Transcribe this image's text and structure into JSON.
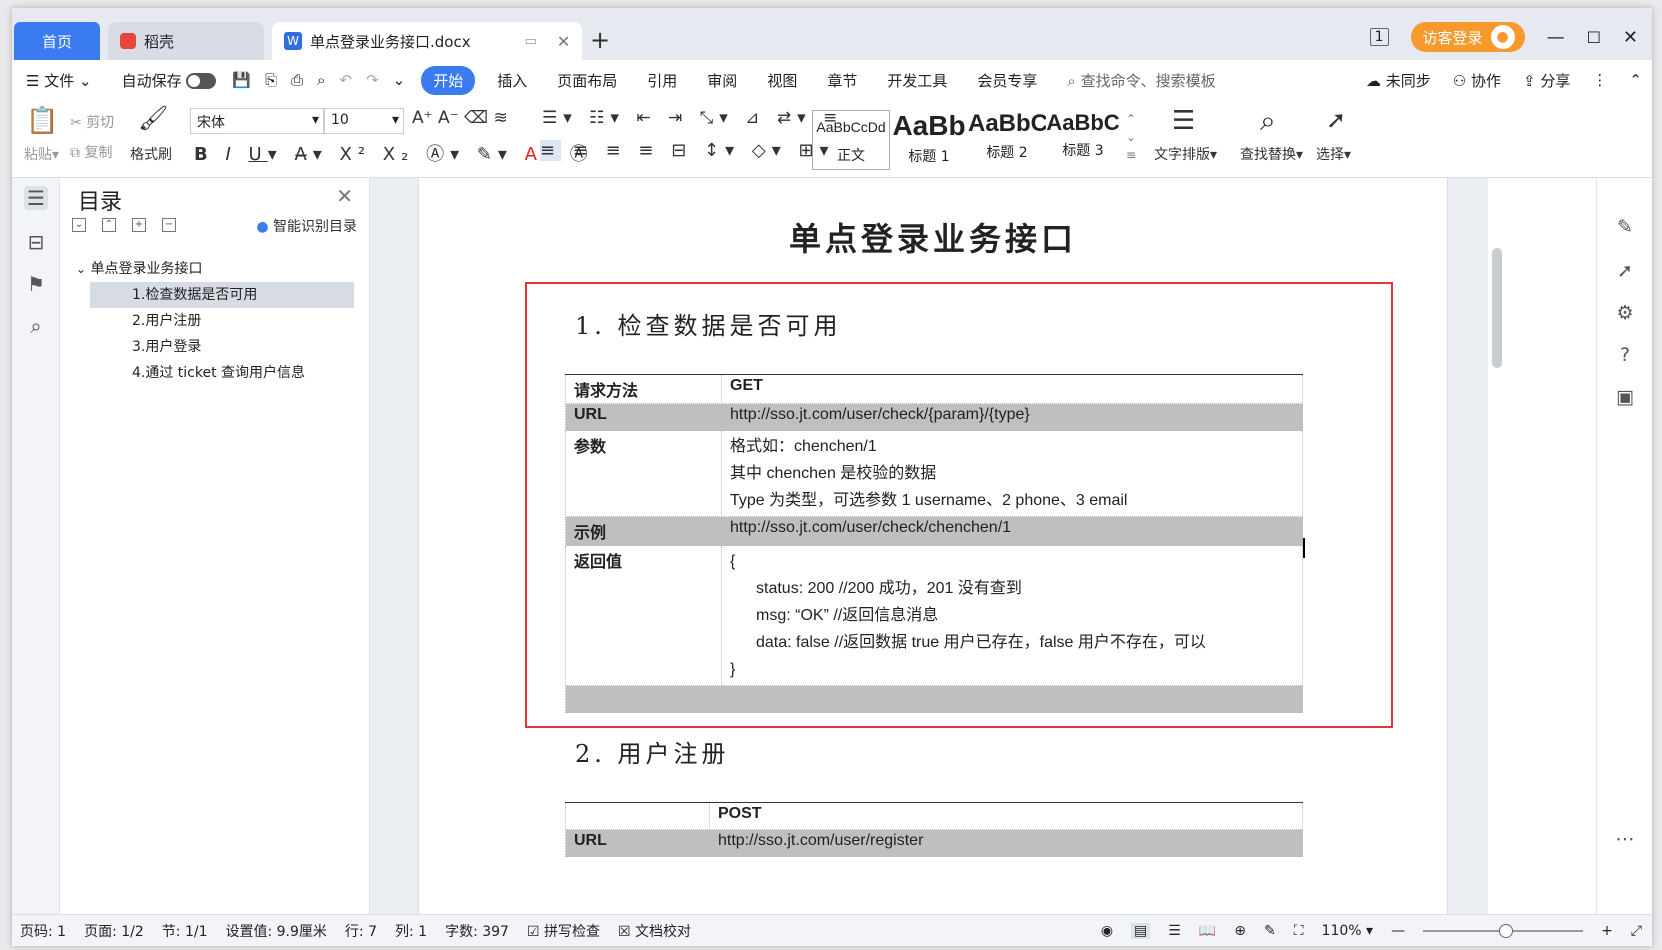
{
  "tabs": {
    "home": "首页",
    "daoke": "稻壳",
    "doc": "单点登录业务接口.docx",
    "add": "+",
    "login": "访客登录"
  },
  "menu": {
    "file": "文件",
    "autosave": "自动保存",
    "items": [
      "开始",
      "插入",
      "页面布局",
      "引用",
      "审阅",
      "视图",
      "章节",
      "开发工具",
      "会员专享"
    ],
    "search": "查找命令、搜索模板",
    "sync": "未同步",
    "collab": "协作",
    "share": "分享"
  },
  "ribbon": {
    "paste": "粘贴",
    "cut": "剪切",
    "copy": "复制",
    "format_painter": "格式刷",
    "font_name": "宋体",
    "font_size": "10",
    "styles": [
      {
        "preview": "AaBbCcDd",
        "name": "正文"
      },
      {
        "preview": "AaBb",
        "name": "标题 1"
      },
      {
        "preview": "AaBbC",
        "name": "标题 2"
      },
      {
        "preview": "AaBbC",
        "name": "标题 3"
      }
    ],
    "text_layout": "文字排版",
    "find_replace": "查找替换",
    "select": "选择"
  },
  "toc": {
    "title": "目录",
    "smart": "智能识别目录",
    "root": "单点登录业务接口",
    "items": [
      "1.检查数据是否可用",
      "2.用户注册",
      "3.用户登录",
      "4.通过 ticket 查询用户信息"
    ]
  },
  "document": {
    "title": "单点登录业务接口",
    "section1": "1. 检查数据是否可用",
    "section2": "2. 用户注册",
    "table1": {
      "method_label": "请求方法",
      "method": "GET",
      "url_label": "URL",
      "url": "http://sso.jt.com/user/check/{param}/{type}",
      "params_label": "参数",
      "params": [
        "格式如：chenchen/1",
        "其中 chenchen 是校验的数据",
        "Type 为类型，可选参数 1 username、2 phone、3 email"
      ],
      "example_label": "示例",
      "example": "http://sso.jt.com/user/check/chenchen/1",
      "return_label": "返回值",
      "return": [
        "{",
        "status: 200   //200  成功，201  没有查到",
        "msg: “OK”   //返回信息消息",
        "data: false   //返回数据 true 用户已存在，false 用户不存在，可以",
        "}"
      ]
    },
    "table2": {
      "method": "POST",
      "url_label": "URL",
      "url": "http://sso.jt.com/user/register"
    }
  },
  "status": {
    "page_no": "页码: 1",
    "pages": "页面: 1/2",
    "section": "节: 1/1",
    "position": "设置值: 9.9厘米",
    "line": "行: 7",
    "col": "列: 1",
    "words": "字数: 397",
    "spell": "拼写检查",
    "proof": "文档校对",
    "zoom": "110%"
  }
}
